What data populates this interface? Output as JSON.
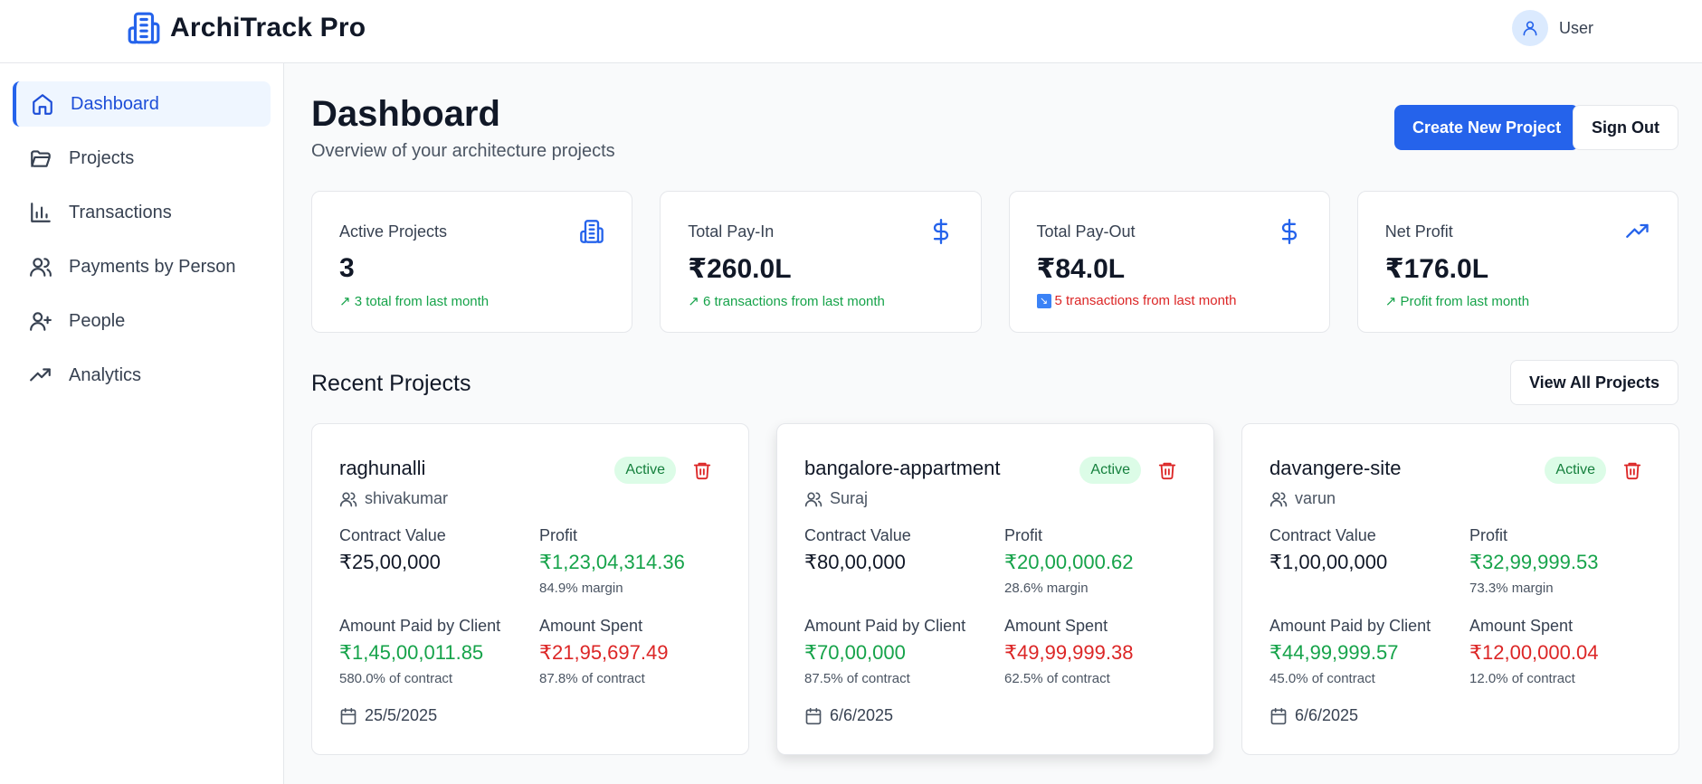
{
  "app": {
    "name": "ArchiTrack Pro"
  },
  "user": {
    "name": "User"
  },
  "sidebar": {
    "items": [
      {
        "label": "Dashboard",
        "icon": "home-icon",
        "active": true
      },
      {
        "label": "Projects",
        "icon": "folder-icon"
      },
      {
        "label": "Transactions",
        "icon": "bar-chart-icon"
      },
      {
        "label": "Payments by Person",
        "icon": "users-icon"
      },
      {
        "label": "People",
        "icon": "user-plus-icon"
      },
      {
        "label": "Analytics",
        "icon": "trending-up-icon"
      }
    ]
  },
  "header": {
    "title": "Dashboard",
    "subtitle": "Overview of your architecture projects",
    "create_label": "Create New Project",
    "signout_label": "Sign Out"
  },
  "stats": [
    {
      "label": "Active Projects",
      "value": "3",
      "trend": "↗ 3 total from last month",
      "icon": "building-icon"
    },
    {
      "label": "Total Pay-In",
      "value": "₹260.0L",
      "trend": "↗ 6 transactions from last month",
      "icon": "dollar-icon"
    },
    {
      "label": "Total Pay-Out",
      "value": "₹84.0L",
      "trend": "5 transactions from last month",
      "icon": "dollar-icon"
    },
    {
      "label": "Net Profit",
      "value": "₹176.0L",
      "trend": "↗ Profit from last month",
      "icon": "trending-up-icon"
    }
  ],
  "recent": {
    "title": "Recent Projects",
    "view_all_label": "View All Projects",
    "labels": {
      "contract": "Contract Value",
      "profit": "Profit",
      "paid": "Amount Paid by Client",
      "spent": "Amount Spent"
    },
    "projects": [
      {
        "name": "raghunalli",
        "status": "Active",
        "owner": "shivakumar",
        "contract": "₹25,00,000",
        "profit": "₹1,23,04,314.36",
        "margin": "84.9% margin",
        "paid": "₹1,45,00,011.85",
        "paid_pct": "580.0% of contract",
        "spent": "₹21,95,697.49",
        "spent_pct": "87.8% of contract",
        "date": "25/5/2025"
      },
      {
        "name": "bangalore-appartment",
        "status": "Active",
        "owner": "Suraj",
        "contract": "₹80,00,000",
        "profit": "₹20,00,000.62",
        "margin": "28.6% margin",
        "paid": "₹70,00,000",
        "paid_pct": "87.5% of contract",
        "spent": "₹49,99,999.38",
        "spent_pct": "62.5% of contract",
        "date": "6/6/2025"
      },
      {
        "name": "davangere-site",
        "status": "Active",
        "owner": "varun",
        "contract": "₹1,00,00,000",
        "profit": "₹32,99,999.53",
        "margin": "73.3% margin",
        "paid": "₹44,99,999.57",
        "paid_pct": "45.0% of contract",
        "spent": "₹12,00,000.04",
        "spent_pct": "12.0% of contract",
        "date": "6/6/2025"
      }
    ]
  },
  "colors": {
    "primary": "#2563eb",
    "green": "#16a34a",
    "red": "#dc2626",
    "badge_bg": "#dcfce7"
  }
}
